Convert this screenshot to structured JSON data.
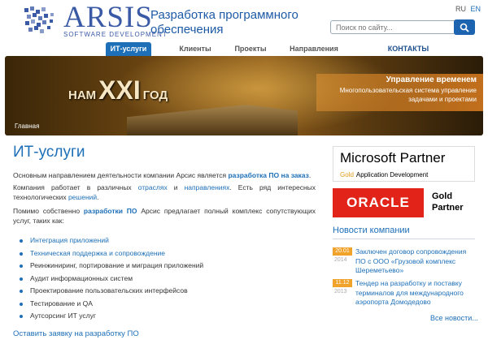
{
  "header": {
    "logo_text": "ARSIS",
    "logo_sub": "SOFTWARE DEVELOPMENT",
    "tagline": "Разработка программного обеспечения",
    "lang_ru": "RU",
    "lang_en": "EN",
    "search_placeholder": "Поиск по сайту..."
  },
  "nav": {
    "items": [
      "ИТ-услуги",
      "Клиенты",
      "Проекты",
      "Направления",
      "КОНТАКТЫ"
    ]
  },
  "banner": {
    "headline_a": "НАМ",
    "headline_b": "XXI",
    "headline_c": "ГОД",
    "promo_title": "Управление временем",
    "promo_desc": "Многопользовательская система управление задачами и проектами",
    "breadcrumb": "Главная"
  },
  "main": {
    "title": "ИТ-услуги",
    "p1_text": "Основным направлением деятельности компании Арсис является ",
    "p1_link": "разработка ПО на заказ",
    "p1_end": ".",
    "p2_text": "Компания работает в различных ",
    "p2_link1": "отраслях",
    "p2_mid": " и ",
    "p2_link2": "направлениях",
    "p2_text2": ". Есть ряд интересных технологических ",
    "p2_link3": "решений",
    "p2_end": ".",
    "p3_text": "Помимо собственно ",
    "p3_link": "разработки ПО",
    "p3_text2": " Арсис предлагает полный комплекс сопутствующих услуг, таких как:",
    "services": [
      "Интеграция приложений",
      "Техническая поддержка и сопровождение",
      "Реинжиниринг, портирование и миграция приложений",
      "Аудит информационных систем",
      "Проектирование пользовательских интерфейсов",
      "Тестирование и QA",
      "Аутсорсинг ИТ услуг"
    ],
    "order_link": "Оставить заявку на разработку ПО"
  },
  "sidebar": {
    "ms_name": "Microsoft Partner",
    "ms_gold": "Gold",
    "ms_sub": "Application Development",
    "oracle": "ORACLE",
    "oracle_gold": "Gold",
    "oracle_partner": "Partner",
    "news_title": "Новости компании",
    "news": [
      {
        "date": "20.01",
        "year": "2014",
        "text": "Заключен договор сопровождения ПО с ООО «Грузовой комплекс Шереметьево»"
      },
      {
        "date": "11.12",
        "year": "2013",
        "text": "Тендер на разработку и поставку терминалов для международного аэропорта Домодедово"
      }
    ],
    "all_news": "Все новости..."
  },
  "colors": {
    "accent": "#1d6fb8",
    "news_date": "#f0a22b",
    "oracle_red": "#e2231a"
  }
}
